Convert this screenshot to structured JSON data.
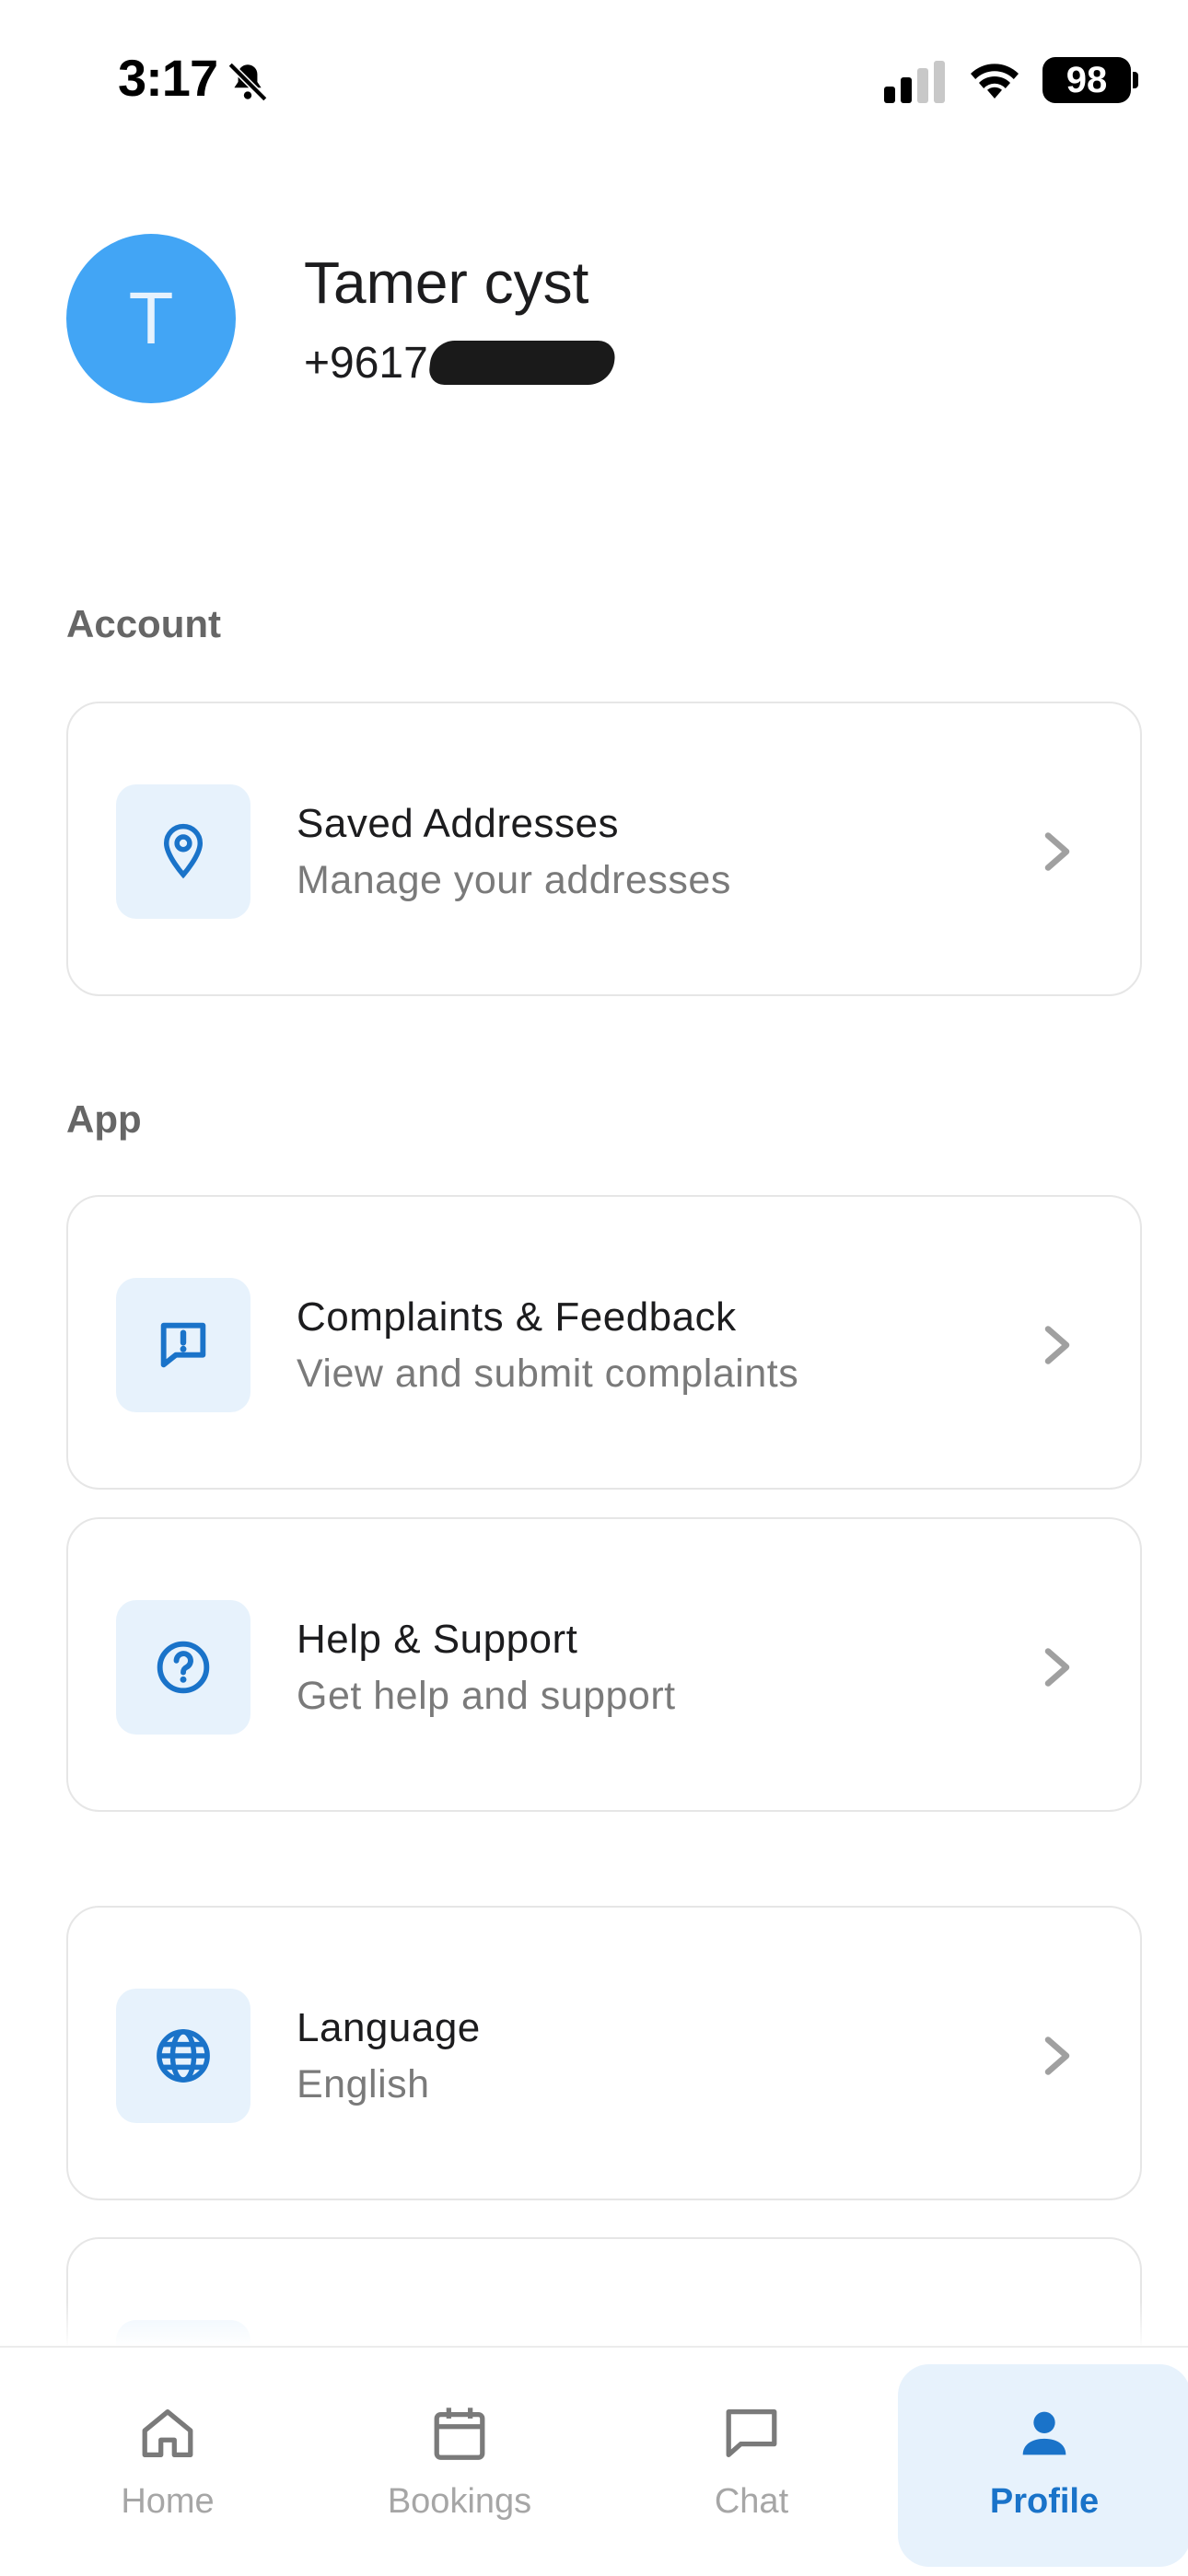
{
  "status_bar": {
    "time": "3:17",
    "battery": "98"
  },
  "profile": {
    "avatar_initial": "T",
    "name": "Tamer cyst",
    "phone": "+9617"
  },
  "sections": {
    "account": {
      "header": "Account"
    },
    "app": {
      "header": "App"
    }
  },
  "cards": {
    "saved_addresses": {
      "title": "Saved Addresses",
      "subtitle": "Manage your addresses",
      "icon": "location-pin-icon"
    },
    "complaints": {
      "title": "Complaints & Feedback",
      "subtitle": "View and submit complaints",
      "icon": "feedback-icon"
    },
    "help": {
      "title": "Help & Support",
      "subtitle": "Get help and support",
      "icon": "help-circle-icon"
    },
    "language": {
      "title": "Language",
      "subtitle": "English",
      "icon": "globe-icon"
    }
  },
  "nav": {
    "home": "Home",
    "bookings": "Bookings",
    "chat": "Chat",
    "profile": "Profile",
    "active": "profile"
  },
  "colors": {
    "accent": "#1a73c9",
    "avatar": "#42a5f5",
    "icon_bg": "#e7f2fc"
  }
}
